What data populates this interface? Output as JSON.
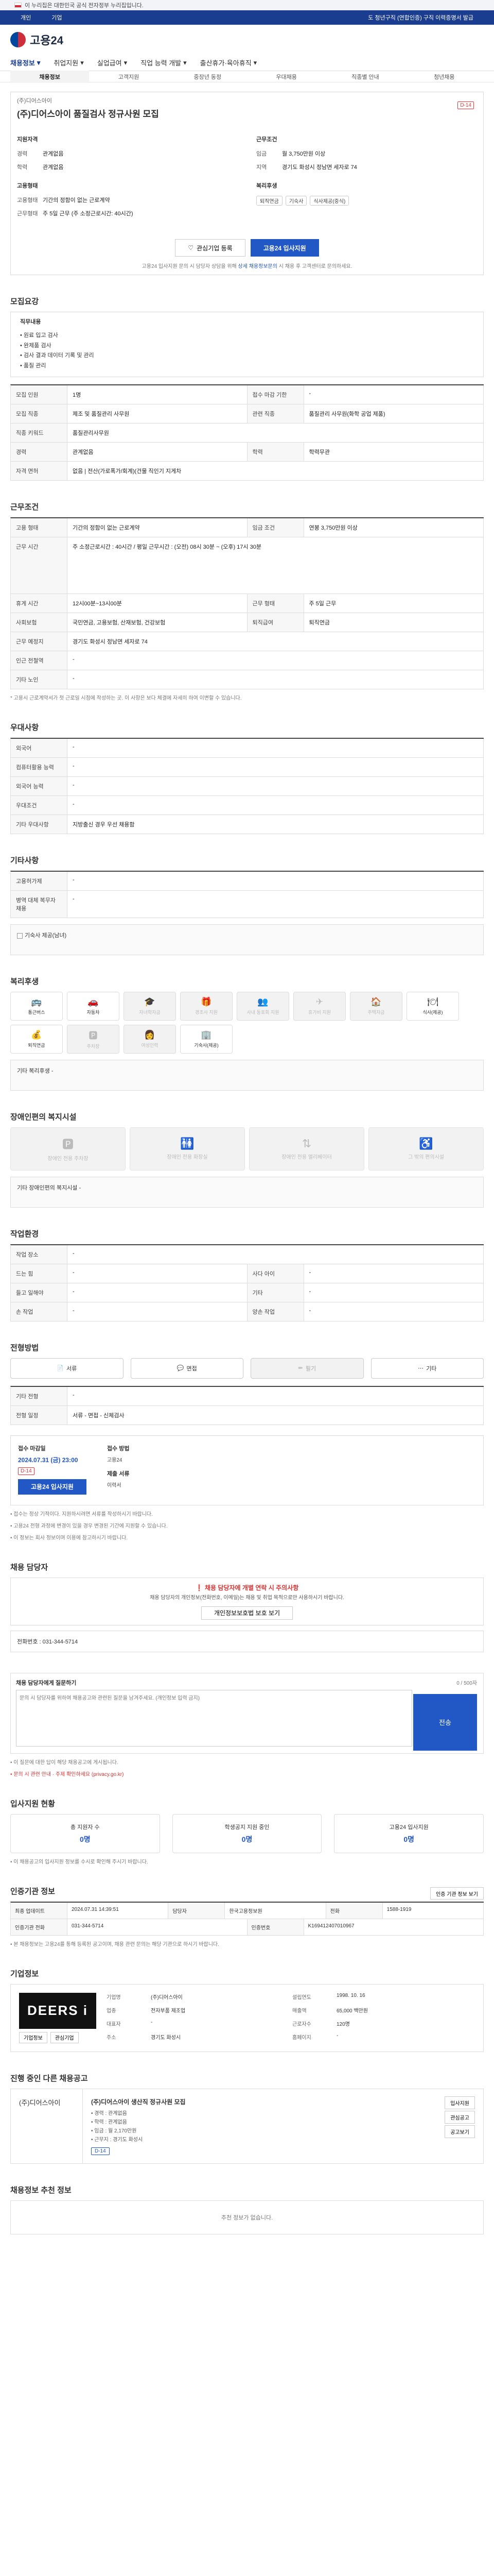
{
  "gov": {
    "notice": "이 누리집은 대한민국 공식 전자정부 누리집입니다."
  },
  "topnav": {
    "left": [
      "개인",
      "기업"
    ],
    "right": "도 청년구직 (연합인증) 구직 이력증명서 발급"
  },
  "logo": {
    "text": "고용24"
  },
  "menu": [
    "채용정보",
    "취업지원",
    "실업급여",
    "직업 능력 개발",
    "출산휴가·육아휴직"
  ],
  "submenu": [
    "채용정보",
    "고객지원",
    "중장년 동정",
    "우대채용",
    "직종별 안내",
    "청년채용"
  ],
  "job": {
    "company": "(주)디어스아이",
    "title": "(주)디어스아이 품질검사 정규사원 모집",
    "dday": "D-14",
    "left_heading": "지원자격",
    "right_heading": "근무조건",
    "fields": [
      {
        "k": "경력",
        "v": "관계없음"
      },
      {
        "k": "학력",
        "v": "관계없음"
      }
    ],
    "rfields": [
      {
        "k": "임금",
        "v": "월 3,750만원 이상"
      },
      {
        "k": "지역",
        "v": "경기도 화성시 정남면 세자로 74"
      }
    ],
    "left_heading2": "고용형태",
    "fields2": [
      {
        "k": "고용형태",
        "v": "기간의 정함이 없는 근로계약"
      },
      {
        "k": "근무형태",
        "v": "주 5일 근무 (주 소정근로시간: 40시간)"
      }
    ],
    "right_heading2": "복리후생",
    "tags": [
      "퇴직연금",
      "기숙사",
      "식사제공(중식)"
    ],
    "interest_btn": "관심기업 등록",
    "apply_btn": "고용24 입사지원",
    "note": "고용24 입사지원 문의 시 담당자 상담을 위해 ",
    "note_link": "상세 채용정보문의",
    "note_tail": " 시 채용 후 고객센터로 문의하세요."
  },
  "desc": {
    "title": "모집요강",
    "box_title": "직무내용",
    "lines": [
      "• 원료 입고 검사",
      "• 완제품 검사",
      "• 검사 결과 데이터 기록 및 관리",
      "• 품질 관리"
    ]
  },
  "req": {
    "rows": [
      {
        "th": "모집 인원",
        "td": "1명",
        "th2": "접수 마감 기한",
        "td2": "-"
      },
      {
        "th": "모집 직종",
        "td": "제조 및 품질관리 사무원",
        "th2": "관련 직종",
        "td2": "품질관리 사무원(화학 공업 제품)"
      },
      {
        "th": "직종 키워드",
        "td": "품질관리사무원"
      },
      {
        "th": "경력",
        "td": "관계없음",
        "th2": "학력",
        "td2": "학력무관"
      },
      {
        "th": "자격 면허",
        "td": "없음 | 전산(가로폭가/회계)(건물 직인기 지게차"
      }
    ]
  },
  "cond": {
    "title": "근무조건",
    "rows": [
      {
        "th": "고용 형태",
        "td": "기간의 정함이 없는 근로계약",
        "th2": "임금 조건",
        "td2": "연봉 3,750만원 이상"
      },
      {
        "th": "근무 시간",
        "td": "주 소정근로시간 : 40시간 / 평일 근무시간 : (오전) 08시 30분 ~ (오후) 17시 30분"
      },
      {
        "th": "휴게 시간",
        "td": "12시00분~13시00분",
        "th2": "근무 형태",
        "td2": "주 5일 근무"
      },
      {
        "th": "사회보험",
        "td": "국민연금, 고용보험, 산재보험, 건강보험",
        "th2": "퇴직급여",
        "td2": "퇴직연금"
      },
      {
        "th": "근무 예정지",
        "td": "경기도 화성시 정남면 세자로 74"
      },
      {
        "th": "인근 전철역",
        "td": "-"
      },
      {
        "th": "기타 노인",
        "td": "-"
      }
    ],
    "note": "* 고용시 근로계약서가 첫 근로일 시점에 작성하는 곳. 이 사항은 보다 체결에 자세히 하여 이변할 수 있습니다."
  },
  "prefer": {
    "title": "우대사항",
    "rows": [
      {
        "th": "외국어",
        "td": "-"
      },
      {
        "th": "컴퓨터활용 능력",
        "td": "-"
      },
      {
        "th": "외국어 능력",
        "td": "-"
      },
      {
        "th": "우대조건",
        "td": "-"
      },
      {
        "th": "기타 우대사항",
        "td": "지방출신 경우 우선 채용함"
      }
    ]
  },
  "etc": {
    "title": "기타사항",
    "rows": [
      {
        "th": "고용허가제",
        "td": "-"
      },
      {
        "th": "병역 대체 복무자 채용",
        "td": "-"
      }
    ],
    "checkbox": "기숙사 제공(남녀)"
  },
  "benefit": {
    "title": "복리후생",
    "items": [
      {
        "label": "통근버스",
        "icon": "🚌",
        "on": true
      },
      {
        "label": "자동차",
        "icon": "🚗",
        "on": true
      },
      {
        "label": "자녀학자금",
        "icon": "🎓",
        "on": false
      },
      {
        "label": "경조사 지원",
        "icon": "🎁",
        "on": false
      },
      {
        "label": "사내 동호회 지원",
        "icon": "👥",
        "on": false
      },
      {
        "label": "휴가비 지원",
        "icon": "✈",
        "on": false
      },
      {
        "label": "주택자금",
        "icon": "🏠",
        "on": false
      },
      {
        "label": "식사(제공)",
        "icon": "🍽",
        "on": true
      },
      {
        "label": "퇴직연금",
        "icon": "💰",
        "on": true
      },
      {
        "label": "주차장",
        "icon": "🅿",
        "on": false
      },
      {
        "label": "여성인력",
        "icon": "👩",
        "on": false
      },
      {
        "label": "기숙사(제공)",
        "icon": "🏢",
        "on": true
      }
    ],
    "etc_label": "기타 복리후생",
    "etc_val": "-"
  },
  "disab": {
    "title": "장애인편의 복지시설",
    "items": [
      "장애인 전용 주차장",
      "장애인 전용 화장실",
      "장애인 전용 엘리베이터",
      "그 밖의 편의시설"
    ],
    "etc_label": "기타 장애인편의 복지시설",
    "etc_val": "-"
  },
  "workplace": {
    "title": "작업환경",
    "rows": [
      {
        "th": "작업 장소",
        "td": "-"
      },
      {
        "th": "드는 힘",
        "td": "-",
        "th2": "사다 아이",
        "td2": "-"
      },
      {
        "th": "들고 일해야",
        "td": "-",
        "th2": "기타",
        "td2": "-"
      },
      {
        "th": "손 작업",
        "td": "-",
        "th2": "양손 작업",
        "td2": "-"
      }
    ]
  },
  "method": {
    "title": "전형방법",
    "items": [
      {
        "label": "서류",
        "icon": "📄",
        "on": true
      },
      {
        "label": "면접",
        "icon": "💬",
        "on": true
      },
      {
        "label": "필기",
        "icon": "✏",
        "on": false
      },
      {
        "label": "기타",
        "icon": "⋯",
        "on": true
      }
    ],
    "rows": [
      {
        "th": "기타 전형",
        "td": "-"
      },
      {
        "th": "전형 일정",
        "td": "서류 - 면접 - 신체검사"
      }
    ]
  },
  "deadline": {
    "h1": "접수 마감일",
    "date": "2024.07.31 (금) 23:00",
    "dday": "D-14",
    "apply_btn": "고용24 입사지원",
    "h2": "접수 방법",
    "method": "고용24",
    "h3": "제출 서류",
    "docs": "이력서",
    "notes": [
      "• 접수는 정상 기적이다. 지원하시려면 서류를 작성하시기 바랍니다.",
      "• 고용24 전형 과정에 변경이 있을 경우 변경된 기간에 지원할 수 있습니다.",
      "• 이 정보는 회사 정보이며 이용에 참고하시기 바랍니다."
    ]
  },
  "contact": {
    "title": "채용 담당자",
    "alert_title": "채용 담당자에 개별 연락 시 주의사항",
    "alert_body": "채용 담당자의 개인정보(전화번호, 이메일)는 채용 및 취업 목적으로만 사용하시기 바랍니다.",
    "alert_btn": "개인정보보호법 보호 보기",
    "phone_label": "전화번호",
    "phone": "031-344-5714"
  },
  "qna": {
    "label": "채용 담당자에게 질문하기",
    "counter": "0 / 500자",
    "placeholder": "문의 시 담당자를 위하여 채용공고와 관련된 질문을 남겨주세요. (개인정보 입력 금지)",
    "send": "전송",
    "note1": "• 이 질문에 대한 답이 해당 채용공고에 게시됩니다.",
    "note2": "• 문의 시 관련 안내 · 주제 확인하세요 (privacy.go.kr)"
  },
  "stats": {
    "title": "입사지원 현황",
    "items": [
      {
        "label": "총 지원자 수",
        "value": "0명"
      },
      {
        "label": "학생공지 지원 중인",
        "value": "0명"
      },
      {
        "label": "고용24 입사지원",
        "value": "0명"
      }
    ],
    "note": "• 이 채용공고의 입사지원 정보를 수시로 확인해 주시기 바랍니다."
  },
  "info": {
    "title": "인증기관 정보",
    "btn": "인증 기관 정보 보기",
    "rows": [
      {
        "th": "최종 업데이트",
        "td": "2024.07.31 14:39:51",
        "th2": "담당자",
        "td2": "한국고용정보원",
        "th3": "전화",
        "td3": "1588-1919"
      },
      {
        "th": "인증기관 전화",
        "td": "031-344-5714",
        "th2": "인증번호",
        "td2": "K169412407010967"
      }
    ],
    "note": "• 본 채용정보는 고용24를 통해 등록된 공고이며, 채용 관련 문의는 해당 기관으로 하시기 바랍니다."
  },
  "corp": {
    "title": "기업정보",
    "logo": "DEERS i",
    "btn1": "기업정보",
    "btn2": "관심기업",
    "meta": [
      {
        "k": "기업명",
        "v": "(주)디어스아이"
      },
      {
        "k": "설립연도",
        "v": "1998. 10. 16"
      },
      {
        "k": "업종",
        "v": "전자부품 제조업"
      },
      {
        "k": "매출액",
        "v": "65,000 백만원"
      },
      {
        "k": "대표자",
        "v": "-"
      },
      {
        "k": "근로자수",
        "v": "120명"
      },
      {
        "k": "주소",
        "v": "경기도 화성시"
      },
      {
        "k": "홈페이지",
        "v": "-"
      }
    ]
  },
  "related": {
    "title": "진행 중인 다른 채용공고",
    "side": "(주)디어스아이",
    "ttl": "(주)디어스아이 생산직 정규사원 모집",
    "info": [
      "• 경력 : 관계없음",
      "• 학력 : 관계없음",
      "• 임금 : 월 2,170만원",
      "• 근무지 : 경기도 화성시"
    ],
    "badge": "D-14",
    "btns": [
      "입사지원",
      "관심공고",
      "공고보기"
    ]
  },
  "recommend": {
    "title": "채용정보 추천 정보",
    "empty": "추천 정보가 없습니다."
  }
}
